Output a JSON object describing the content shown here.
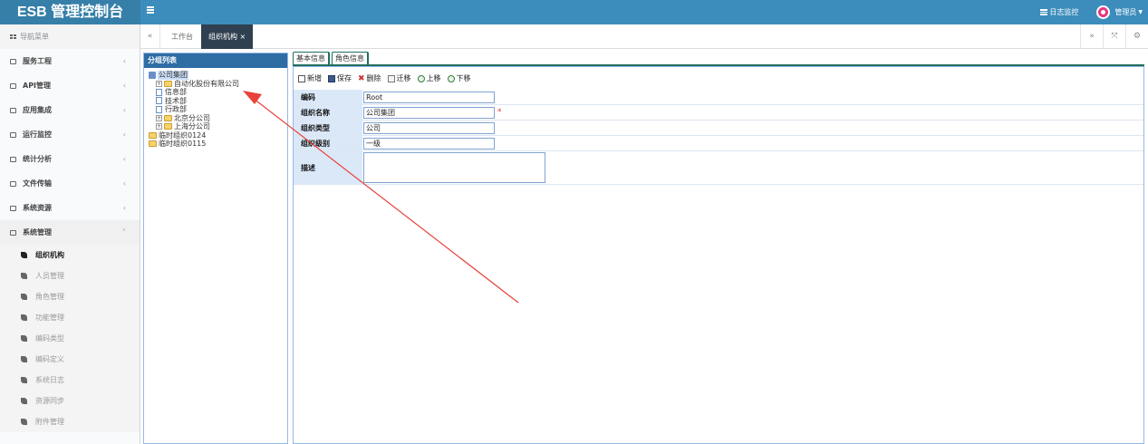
{
  "app": {
    "title": "ESB 管理控制台"
  },
  "header": {
    "log_monitor": "日志监控",
    "user": "管理员"
  },
  "sidebar": {
    "heading": "导航菜单",
    "menus": [
      {
        "label": "服务工程"
      },
      {
        "label": "API管理"
      },
      {
        "label": "应用集成"
      },
      {
        "label": "运行监控"
      },
      {
        "label": "统计分析"
      },
      {
        "label": "文件传输"
      },
      {
        "label": "系统资源"
      },
      {
        "label": "系统管理"
      }
    ],
    "submenus": [
      {
        "label": "组织机构"
      },
      {
        "label": "人员管理"
      },
      {
        "label": "角色管理"
      },
      {
        "label": "功能管理"
      },
      {
        "label": "编码类型"
      },
      {
        "label": "编码定义"
      },
      {
        "label": "系统日志"
      },
      {
        "label": "资源同步"
      },
      {
        "label": "附件管理"
      }
    ]
  },
  "tabs": {
    "home": "工作台",
    "active": "组织机构",
    "close": "×"
  },
  "tree_panel": {
    "title": "分组列表",
    "nodes": [
      "公司集团",
      "自动化股份有限公司",
      "信息部",
      "技术部",
      "行政部",
      "北京分公司",
      "上海分公司",
      "临时组织0124",
      "临时组织0115"
    ]
  },
  "detail": {
    "tabs": [
      "基本信息",
      "角色信息"
    ],
    "toolbar": {
      "new": "新增",
      "save": "保存",
      "delete": "删除",
      "move": "迁移",
      "up": "上移",
      "down": "下移"
    },
    "fields": {
      "code": {
        "label": "编码",
        "value": "Root"
      },
      "name": {
        "label": "组织名称",
        "value": "公司集团",
        "required": "*"
      },
      "type": {
        "label": "组织类型",
        "value": "公司"
      },
      "level": {
        "label": "组织级别",
        "value": "一级"
      },
      "desc": {
        "label": "描述",
        "value": ""
      }
    }
  },
  "colors": {
    "header": "#3c8dbc",
    "brand": "#367fa9",
    "active_tab": "#2f4050",
    "panel_title": "#2e6da4",
    "annotation_arrow": "#e8423a"
  }
}
